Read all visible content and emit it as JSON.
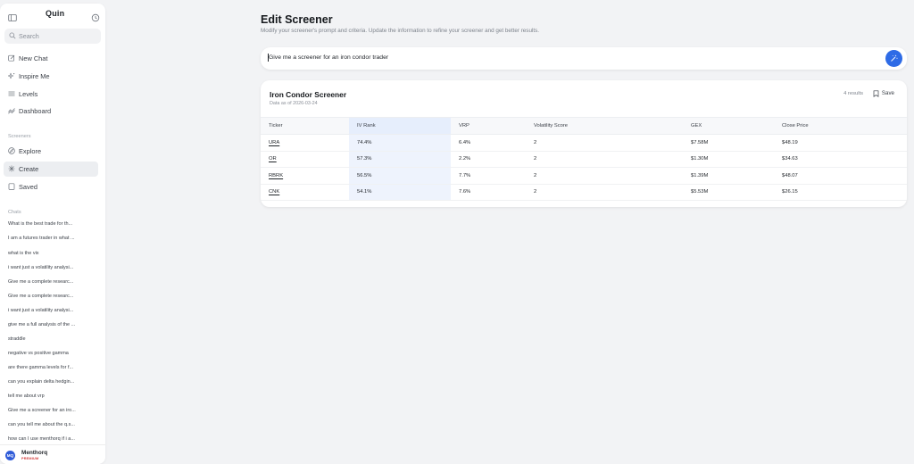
{
  "sidebar": {
    "logo": "Quin",
    "search_placeholder": "Search",
    "nav": [
      {
        "label": "New Chat",
        "icon": "edit-icon"
      },
      {
        "label": "Inspire Me",
        "icon": "sparkle-icon"
      },
      {
        "label": "Levels",
        "icon": "levels-icon"
      },
      {
        "label": "Dashboard",
        "icon": "dashboard-icon"
      }
    ],
    "screeners_label": "Screeners",
    "screeners": [
      {
        "label": "Explore",
        "icon": "compass-icon"
      },
      {
        "label": "Create",
        "icon": "create-icon"
      },
      {
        "label": "Saved",
        "icon": "bookmark-icon"
      }
    ],
    "chats_label": "Chats",
    "chats": [
      "What is the best trade for th...",
      "I am a futures trader in what ...",
      "what is the vix",
      "i want just a volatility analysi...",
      "Give me a complete researc...",
      "Give me a complete researc...",
      "i want just a volatility analysi...",
      "give me a full analysis of the ...",
      "straddle",
      "negative vs positive gamma",
      "are there gamma levels for f...",
      "can you explain delta hedgin...",
      "tell me about vrp",
      "Give me a screener for an iro...",
      "can you tell me about the q.s...",
      "how can I use menthorq if i a..."
    ],
    "user": {
      "initials": "MQ",
      "name": "Menthorq",
      "plan": "PREMIUM"
    }
  },
  "main": {
    "title": "Edit Screener",
    "subtitle": "Modify your screener's prompt and criteria. Update the information to refine your screener and get better results.",
    "prompt": "Give me a screener for an iron condor trader"
  },
  "card": {
    "title": "Iron Condor Screener",
    "date": "Data as of 2026-03-24",
    "results": "4 results",
    "save_label": "Save",
    "columns": [
      "Ticker",
      "IV Rank",
      "VRP",
      "Volatility Score",
      "GEX",
      "Close Price"
    ],
    "rows": [
      [
        "URA",
        "74.4%",
        "6.4%",
        "2",
        "$7.58M",
        "$48.19"
      ],
      [
        "OR",
        "57.3%",
        "2.2%",
        "2",
        "$1.30M",
        "$34.63"
      ],
      [
        "RBRK",
        "56.5%",
        "7.7%",
        "2",
        "$1.39M",
        "$48.07"
      ],
      [
        "CNK",
        "54.1%",
        "7.6%",
        "2",
        "$5.53M",
        "$26.15"
      ]
    ]
  },
  "colors": {
    "accent": "#2e6be6",
    "highlight_column": "#eef3fd",
    "premium": "#d23b3b"
  }
}
